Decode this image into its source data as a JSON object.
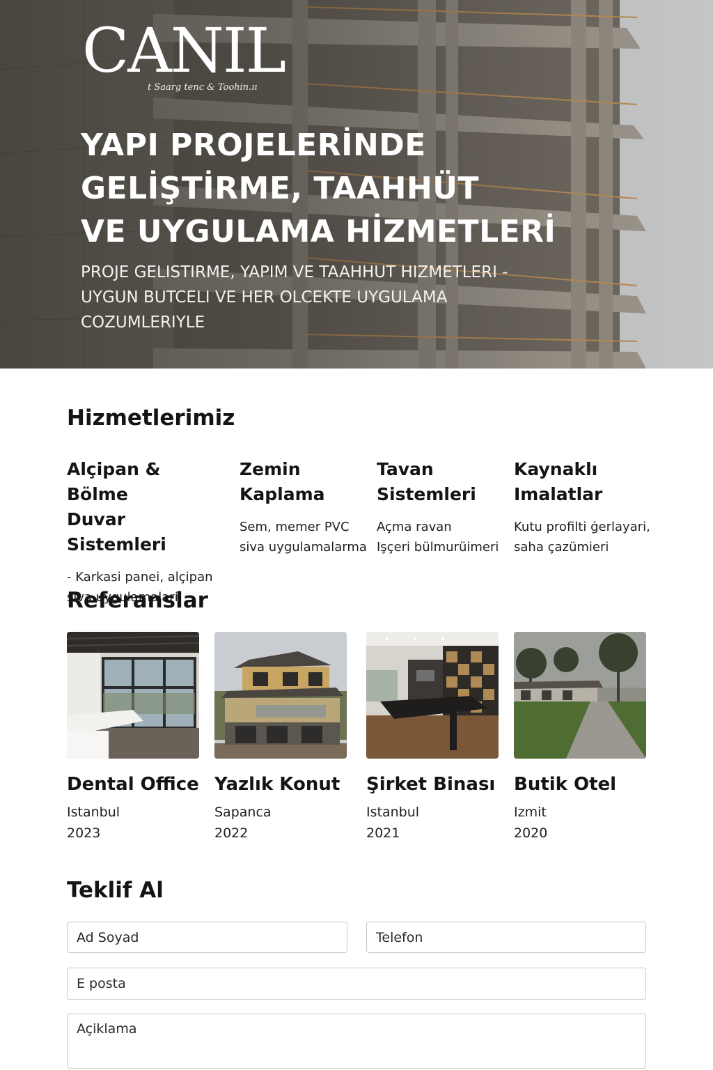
{
  "hero": {
    "logo_mark": "CANIL",
    "logo_tagline": "t Saarg tenc & Toohin.ıı",
    "title_lines": [
      "YAPI PROJELERİNDE",
      "GELİŞTİRME, TAAHHÜT",
      "VE UYGULAMA HİZMETLERİ"
    ],
    "subtitle_lines": [
      "PROJE GELISTIRME, YAPIM VE TAAHHUT HIZMETLERI -",
      "UYGUN BUTCELI VE HER OLCEKTE UYGULAMA",
      "COZUMLERIYLE"
    ]
  },
  "services": {
    "heading": "Hizmetlerimiz",
    "items": [
      {
        "title_lines": [
          "Alçipan & Bölme",
          "Duvar Sistemleri"
        ],
        "desc_lines": [
          "- Karkasi panei, alçipan",
          "siva uygulamalari"
        ]
      },
      {
        "title_lines": [
          "Zemin",
          "Kaplama"
        ],
        "desc_lines": [
          "Sem, memer PVC",
          "siva uygulamalarma"
        ]
      },
      {
        "title_lines": [
          "Tavan",
          "Sistemleri"
        ],
        "desc_lines": [
          "Açma ravan",
          "Işçeri bülmurüimeri"
        ]
      },
      {
        "title_lines": [
          "Kaynaklı",
          "Imalatlar"
        ],
        "desc_lines": [
          "Kutu profilti ģerlayari,",
          "saha çazümieri"
        ]
      }
    ]
  },
  "references": {
    "heading": "Referanslar",
    "items": [
      {
        "title": "Dental Office",
        "city": "Istanbul",
        "year": "2023"
      },
      {
        "title": "Yazlık Konut",
        "city": "Sapanca",
        "year": "2022"
      },
      {
        "title": "Şirket Binası",
        "city": "Istanbul",
        "year": "2021"
      },
      {
        "title": "Butik Otel",
        "city": "Izmit",
        "year": "2020"
      }
    ]
  },
  "quote_form": {
    "heading": "Teklif Al",
    "name_placeholder": "Ad Soyad",
    "phone_placeholder": "Telefon",
    "email_placeholder": "E posta",
    "description_placeholder": "Açiklama"
  }
}
